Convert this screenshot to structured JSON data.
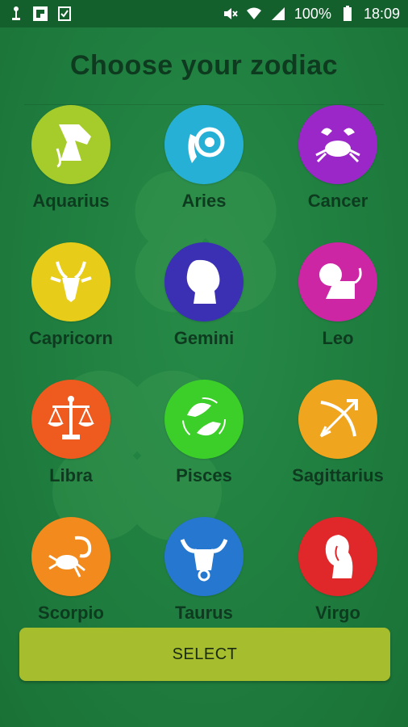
{
  "status_bar": {
    "left_icons": [
      "usb-icon",
      "flipboard-icon",
      "clipboard-check-icon"
    ],
    "right_icons": [
      "mute-icon",
      "wifi-icon",
      "signal-icon",
      "battery-icon"
    ],
    "battery": "100%",
    "time": "18:09"
  },
  "title": "Choose your zodiac",
  "signs": [
    {
      "name": "Aquarius",
      "color": "#a6cc2c",
      "icon": "aquarius-icon"
    },
    {
      "name": "Aries",
      "color": "#27b0d6",
      "icon": "aries-icon"
    },
    {
      "name": "Cancer",
      "color": "#9b27c9",
      "icon": "cancer-icon"
    },
    {
      "name": "Capricorn",
      "color": "#e7cd19",
      "icon": "capricorn-icon"
    },
    {
      "name": "Gemini",
      "color": "#3b30b3",
      "icon": "gemini-icon"
    },
    {
      "name": "Leo",
      "color": "#cc26a4",
      "icon": "leo-icon"
    },
    {
      "name": "Libra",
      "color": "#ef5a1f",
      "icon": "libra-icon"
    },
    {
      "name": "Pisces",
      "color": "#3ccf2a",
      "icon": "pisces-icon"
    },
    {
      "name": "Sagittarius",
      "color": "#f0a51f",
      "icon": "sagittarius-icon"
    },
    {
      "name": "Scorpio",
      "color": "#f28a1d",
      "icon": "scorpio-icon"
    },
    {
      "name": "Taurus",
      "color": "#2677cf",
      "icon": "taurus-icon"
    },
    {
      "name": "Virgo",
      "color": "#e0282b",
      "icon": "virgo-icon"
    }
  ],
  "select_button": "SELECT"
}
